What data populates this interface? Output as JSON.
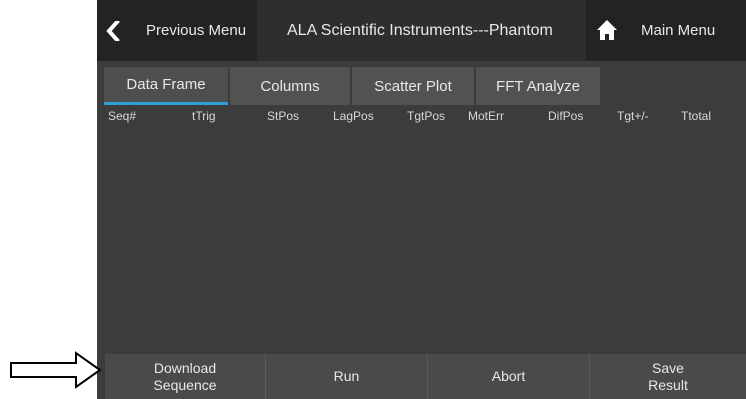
{
  "topbar": {
    "back_icon": "chevron-left-icon",
    "previous_label": "Previous Menu",
    "title": "ALA Scientific Instruments---Phantom",
    "home_icon": "home-icon",
    "main_label": "Main Menu"
  },
  "tabs": [
    {
      "label": "Data Frame",
      "active": true
    },
    {
      "label": "Columns",
      "active": false
    },
    {
      "label": "Scatter Plot",
      "active": false
    },
    {
      "label": "FFT Analyze",
      "active": false
    }
  ],
  "table": {
    "columns": [
      "Seq#",
      "tTrig",
      "StPos",
      "LagPos",
      "TgtPos",
      "MotErr",
      "DifPos",
      "Tgt+/-",
      "Ttotal"
    ],
    "rows": []
  },
  "buttons": {
    "download_line1": "Download",
    "download_line2": "Sequence",
    "run": "Run",
    "abort": "Abort",
    "save_line1": "Save",
    "save_line2": "Result"
  },
  "annotation": {
    "pointer_icon": "right-arrow-outline-icon"
  },
  "colors": {
    "background": "#3c3c3c",
    "topbar": "#232323",
    "tab": "#525252",
    "tab_active_underline": "#2ea0d8",
    "text": "#e8e8e8"
  }
}
